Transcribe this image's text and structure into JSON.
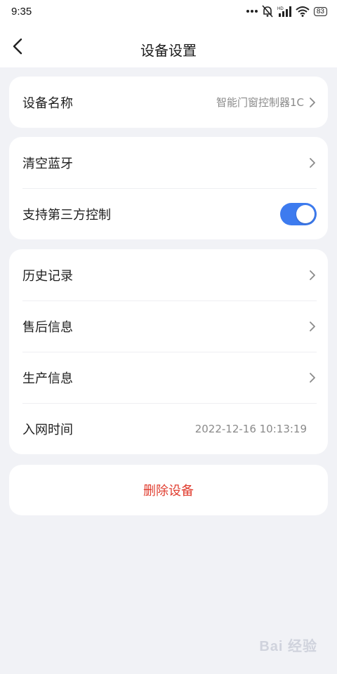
{
  "status_bar": {
    "time": "9:35",
    "battery": "83",
    "signal_label": "HD"
  },
  "header": {
    "title": "设备设置"
  },
  "card_device": {
    "name_label": "设备名称",
    "name_value": "智能门窗控制器1C"
  },
  "card_bluetooth": {
    "clear_label": "清空蓝牙",
    "third_party_label": "支持第三方控制",
    "third_party_enabled": true
  },
  "card_info": {
    "history_label": "历史记录",
    "after_sales_label": "售后信息",
    "production_label": "生产信息",
    "network_time_label": "入网时间",
    "network_time_value": "2022-12-16 10:13:19"
  },
  "delete_button": {
    "label": "删除设备"
  },
  "watermark": {
    "text": "Bai 经验"
  },
  "colors": {
    "accent": "#3d7bef",
    "danger": "#e03d2f",
    "background": "#f1f2f6"
  }
}
